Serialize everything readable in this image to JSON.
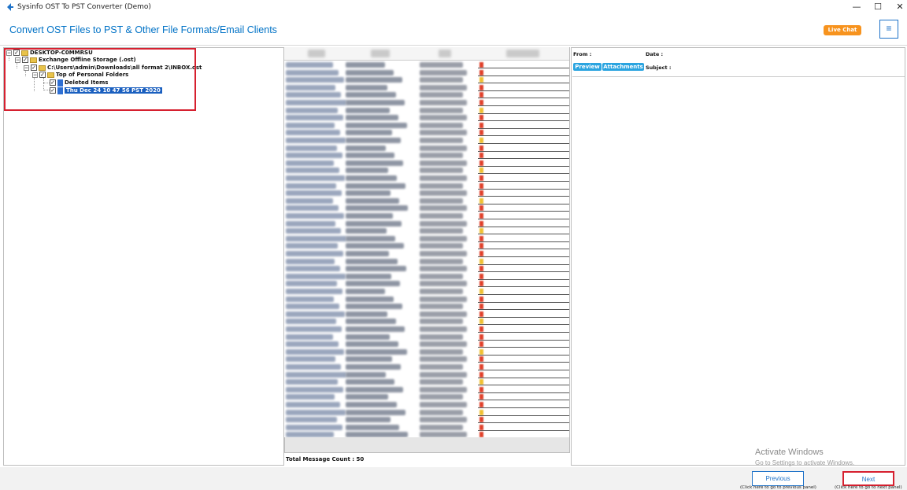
{
  "window": {
    "title": "Sysinfo OST To PST Converter (Demo)",
    "minimize": "—",
    "maximize": "☐",
    "close": "✕"
  },
  "header": {
    "title": "Convert OST Files to PST & Other File Formats/Email Clients",
    "live_chat": "Live Chat",
    "menu_icon": "≡"
  },
  "tree": {
    "nodes": [
      {
        "label": "DESKTOP-C0MMRSU",
        "icon": "computer-icon"
      },
      {
        "label": "Exchange Offline Storage (.ost)",
        "icon": "folder-icon"
      },
      {
        "label": "C:\\Users\\admin\\Downloads\\all format 2\\INBOX.ost",
        "icon": "folder-icon"
      },
      {
        "label": "Top of Personal Folders",
        "icon": "folder-icon"
      },
      {
        "label": "Deleted Items",
        "icon": "file-icon"
      },
      {
        "label": "Thu Dec 24 10 47 56 PST 2020",
        "icon": "file-icon",
        "selected": true
      }
    ]
  },
  "message_list": {
    "total_label": "Total Message Count : 50",
    "row_count": 50
  },
  "preview": {
    "from_label": "From :",
    "date_label": "Date :",
    "subject_label": "Subject :",
    "tabs": [
      "Preview",
      "Attachments"
    ]
  },
  "watermark": {
    "line1": "Activate Windows",
    "line2": "Go to Settings to activate Windows."
  },
  "footer": {
    "previous_label": "Previous",
    "previous_hint": "(Click here to go to previous panel)",
    "next_label": "Next",
    "next_hint": "(Click here to go to next panel)"
  },
  "colors": {
    "accent": "#0072c6",
    "live_chat": "#f7931e",
    "tab": "#2aa4e0",
    "highlight": "#d6202f",
    "selected": "#1a5fbf"
  }
}
